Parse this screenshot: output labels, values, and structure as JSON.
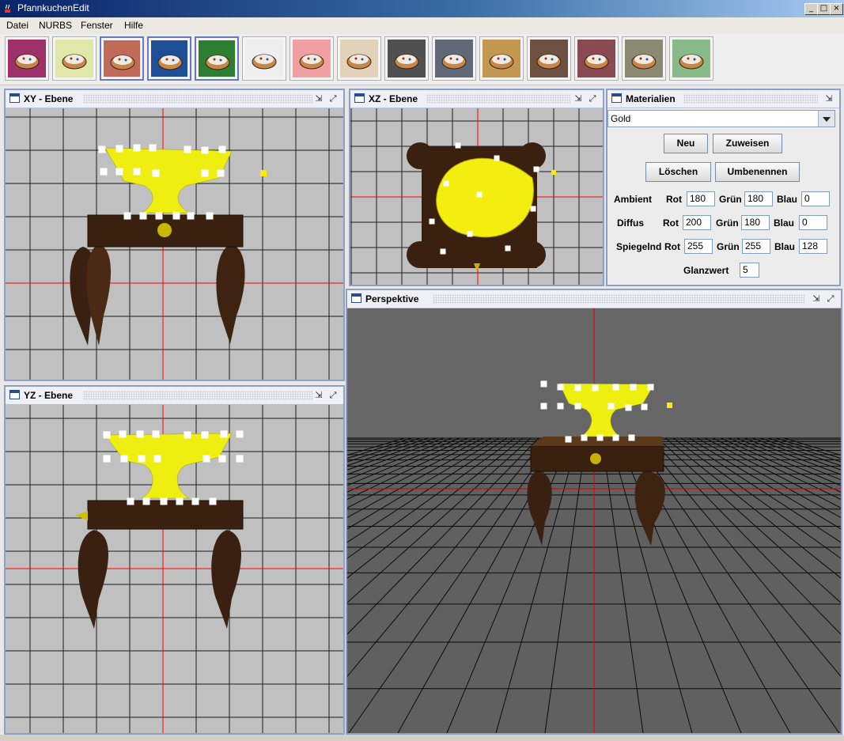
{
  "app": {
    "title": "PfannkuchenEdit"
  },
  "menu": [
    {
      "label": "Datei"
    },
    {
      "label": "NURBS"
    },
    {
      "label": "Fenster"
    },
    {
      "label": "Hilfe"
    }
  ],
  "toolbar": {
    "items": [
      {
        "icon": "settings-pancake-icon",
        "color": "#a0306a"
      },
      {
        "icon": "select-pancake-icon",
        "color": "#dfe8a8"
      },
      {
        "icon": "edit-points-icon",
        "color": "#c06a5a"
      },
      {
        "icon": "pointer-select-icon",
        "color": "#1e4f96"
      },
      {
        "icon": "move-pancake-icon",
        "color": "#2e7e32"
      },
      {
        "icon": "sketch-pancake-icon",
        "color": "#eeeeee"
      },
      {
        "icon": "rotate-pancake-icon",
        "color": "#f0a0a0"
      },
      {
        "icon": "array-pancakes-icon",
        "color": "#e2d2b8"
      },
      {
        "icon": "particles-icon",
        "color": "#505050"
      },
      {
        "icon": "scale-icon",
        "color": "#606878"
      },
      {
        "icon": "donut-icon",
        "color": "#c49850"
      },
      {
        "icon": "cut-donut-icon",
        "color": "#6c5040"
      },
      {
        "icon": "slice-donut-icon",
        "color": "#8a4a52"
      },
      {
        "icon": "roll-icon",
        "color": "#8a8a70"
      },
      {
        "icon": "render-light-icon",
        "color": "#88bb88"
      }
    ]
  },
  "views": {
    "xy": {
      "title": "XY - Ebene"
    },
    "xz": {
      "title": "XZ - Ebene"
    },
    "yz": {
      "title": "YZ - Ebene"
    },
    "perspective": {
      "title": "Perspektive"
    }
  },
  "materials": {
    "title": "Materialien",
    "selected": "Gold",
    "buttons": {
      "new": "Neu",
      "assign": "Zuweisen",
      "delete": "Löschen",
      "rename": "Umbenennen"
    },
    "rows": [
      {
        "label": "Ambient",
        "r": "180",
        "g": "180",
        "b": "0"
      },
      {
        "label": "Diffus",
        "r": "200",
        "g": "180",
        "b": "0"
      },
      {
        "label": "Spiegelnd",
        "r": "255",
        "g": "255",
        "b": "128"
      }
    ],
    "channel_labels": {
      "r": "Rot",
      "g": "Grün",
      "b": "Blau"
    },
    "shininess": {
      "label": "Glanzwert",
      "value": "5"
    }
  },
  "colors": {
    "viewport_bg": "#c0c0c0",
    "grid": "#000000",
    "axis": "#ff0000",
    "gold": "#f5f000",
    "wood": "#3a210f",
    "perspective_bg": "#606060"
  }
}
